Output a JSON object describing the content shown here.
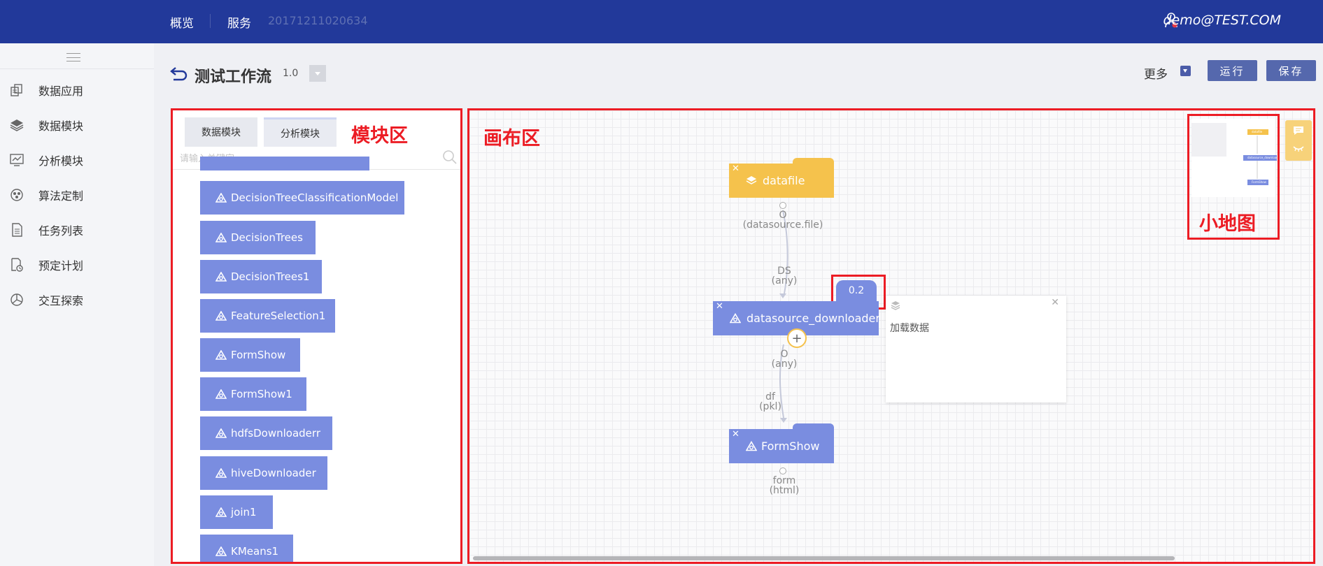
{
  "topbar": {
    "nav_overview": "概览",
    "nav_services": "服务",
    "nav_id": "20171211020634",
    "user": "demo@TEST.COM"
  },
  "sidebar": {
    "items": [
      {
        "label": "数据应用",
        "icon": "data-app-icon"
      },
      {
        "label": "数据模块",
        "icon": "layers-icon"
      },
      {
        "label": "分析模块",
        "icon": "monitor-chart-icon"
      },
      {
        "label": "算法定制",
        "icon": "algorithm-icon"
      },
      {
        "label": "任务列表",
        "icon": "task-list-icon"
      },
      {
        "label": "预定计划",
        "icon": "schedule-icon"
      },
      {
        "label": "交互探索",
        "icon": "explore-icon"
      }
    ]
  },
  "header": {
    "title": "测试工作流",
    "version": "1.0",
    "more": "更多",
    "run": "运行",
    "save": "保存"
  },
  "module_panel": {
    "tabs": [
      "数据模块",
      "分析模块"
    ],
    "annotation": "模块区",
    "search_placeholder": "请输入关键字",
    "items": [
      "DecisionTreeClassificationModel",
      "DecisionTrees",
      "DecisionTrees1",
      "FeatureSelection1",
      "FormShow",
      "FormShow1",
      "hdfsDownloaderr",
      "hiveDownloader",
      "join1",
      "KMeans1"
    ]
  },
  "canvas": {
    "annotation": "画布区",
    "nodes": {
      "datafile": {
        "label": "datafile",
        "out_name": "O",
        "out_type": "(datasource.file)",
        "color": "#f5c24c"
      },
      "downloader": {
        "label": "datasource_downloader",
        "in_name": "DS",
        "in_type": "(any)",
        "out_name": "O",
        "out_type": "(any)",
        "badge": "0.2",
        "color": "#7a8de0"
      },
      "formshow": {
        "label": "FormShow",
        "in_name": "df",
        "in_type": "(pkl)",
        "out_name": "form",
        "out_type": "(html)",
        "color": "#7a8de0"
      }
    },
    "info_panel": {
      "text": "加载数据"
    },
    "minimap_annotation": "小地图",
    "minimap_nodes": [
      "datafile",
      "datasource_downloader",
      "FormShow"
    ]
  }
}
